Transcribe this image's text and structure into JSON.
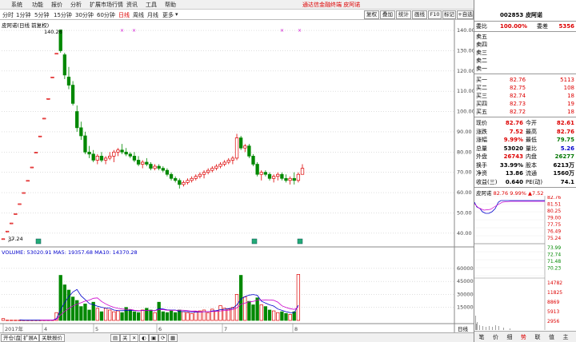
{
  "menu": [
    "系统",
    "功能",
    "报价",
    "分析",
    "扩展市场行情",
    "资讯",
    "工具",
    "帮助"
  ],
  "banner": "通达信金融终端  皮阿诺",
  "window_buttons": [
    "行情",
    "资讯",
    "交易",
    "服务"
  ],
  "periods": [
    "分时",
    "1分钟",
    "5分钟",
    "15分钟",
    "30分钟",
    "60分钟",
    "日线",
    "周线",
    "月线",
    "更多"
  ],
  "period_active": "日线",
  "toolbar_buttons": [
    "复权",
    "叠加",
    "统计",
    "画线",
    "F10",
    "标记",
    "+自选",
    "返回"
  ],
  "chart_title": "皮阿诺(日线 前复权)",
  "chart_data": {
    "type": "candlestick",
    "ylim": [
      34,
      142
    ],
    "yticks": [
      40,
      50,
      60,
      70,
      80,
      90,
      100,
      110,
      120,
      130,
      140
    ],
    "ytick_labels": [
      "40.00",
      "50.00",
      "60.00",
      "70.00",
      "80.00",
      "90.00",
      "100.00",
      "110.00",
      "120.00",
      "130.00",
      "140.00"
    ],
    "max_label": "140.26",
    "min_label": "37.24",
    "candles": [
      [
        37.24,
        37.24,
        37.24,
        37.24
      ],
      [
        41,
        41,
        41,
        41
      ],
      [
        45,
        45,
        45,
        45
      ],
      [
        49.6,
        49.6,
        49.6,
        49.6
      ],
      [
        54.5,
        54.5,
        54.5,
        54.5
      ],
      [
        60,
        60,
        60,
        60
      ],
      [
        66,
        66,
        66,
        66
      ],
      [
        72.6,
        72.6,
        72.6,
        72.6
      ],
      [
        79.9,
        79.9,
        79.9,
        79.9
      ],
      [
        87.9,
        87.9,
        87.9,
        87.9
      ],
      [
        96.7,
        96.7,
        96.7,
        96.7
      ],
      [
        106.4,
        106.4,
        106.4,
        106.4
      ],
      [
        117,
        117,
        117,
        117
      ],
      [
        128.7,
        128.7,
        128.7,
        128.7
      ],
      [
        140.26,
        129,
        140.26,
        130
      ],
      [
        128,
        116,
        129,
        118
      ],
      [
        117,
        111,
        122,
        113
      ],
      [
        113,
        103,
        115,
        104
      ],
      [
        100,
        90,
        103,
        92
      ],
      [
        92,
        86,
        95,
        88
      ],
      [
        88,
        79,
        90,
        80
      ],
      [
        80,
        77,
        83,
        79
      ],
      [
        79,
        75,
        81,
        76
      ],
      [
        76,
        74,
        79,
        78
      ],
      [
        78,
        75,
        80,
        76
      ],
      [
        76,
        74,
        78,
        77
      ],
      [
        77,
        76,
        80,
        78
      ],
      [
        78,
        75,
        81,
        80
      ],
      [
        80,
        78,
        82,
        81
      ],
      [
        81,
        79,
        84,
        80
      ],
      [
        80,
        78,
        82,
        79
      ],
      [
        79,
        77,
        80,
        78
      ],
      [
        78,
        75,
        80,
        76
      ],
      [
        76,
        73,
        78,
        74
      ],
      [
        74,
        72,
        76,
        75
      ],
      [
        75,
        73,
        77,
        74
      ],
      [
        74,
        71,
        75,
        72
      ],
      [
        72,
        71,
        74,
        73
      ],
      [
        73,
        71,
        74,
        72
      ],
      [
        72,
        70,
        73,
        71
      ],
      [
        71,
        68,
        72,
        69
      ],
      [
        69,
        66,
        70,
        67
      ],
      [
        67,
        65,
        68,
        66
      ],
      [
        66,
        62,
        67,
        64
      ],
      [
        64,
        63,
        66,
        65
      ],
      [
        65,
        64,
        67,
        66
      ],
      [
        66,
        65,
        68,
        67
      ],
      [
        67,
        66,
        69,
        68
      ],
      [
        68,
        67,
        70,
        69
      ],
      [
        69,
        67,
        71,
        70
      ],
      [
        70,
        69,
        72,
        71
      ],
      [
        71,
        70,
        73,
        72
      ],
      [
        72,
        71,
        74,
        73
      ],
      [
        73,
        72,
        75,
        74
      ],
      [
        74,
        73,
        76,
        75
      ],
      [
        75,
        74,
        77,
        76
      ],
      [
        76,
        74,
        78,
        77
      ],
      [
        77,
        76,
        89,
        87
      ],
      [
        87,
        81,
        88,
        82
      ],
      [
        82,
        80,
        84,
        83
      ],
      [
        83,
        77,
        84,
        78
      ],
      [
        78,
        73,
        79,
        74
      ],
      [
        74,
        68,
        75,
        69
      ],
      [
        69,
        66,
        71,
        70
      ],
      [
        70,
        68,
        71,
        69
      ],
      [
        69,
        66,
        70,
        67
      ],
      [
        67,
        65,
        69,
        68
      ],
      [
        68,
        66,
        70,
        69
      ],
      [
        69,
        66,
        70,
        67
      ],
      [
        67,
        65,
        69,
        66
      ],
      [
        66,
        64,
        68,
        67
      ],
      [
        67,
        64,
        70,
        66
      ],
      [
        66,
        65,
        70,
        69
      ],
      [
        69,
        72,
        74,
        72
      ]
    ],
    "volume_title": "VOLUME: 53020.91  MA5: 19357.68  MA10: 14370.28",
    "volume_ylim": [
      0,
      70000
    ],
    "volume_ticks": [
      15000,
      30000,
      45000,
      60000
    ],
    "volumes": [
      2100,
      300,
      280,
      260,
      250,
      240,
      230,
      230,
      230,
      240,
      260,
      280,
      320,
      9000,
      52000,
      41000,
      35000,
      27000,
      23000,
      16000,
      19000,
      12000,
      21000,
      14000,
      10000,
      14000,
      12000,
      10000,
      11000,
      9000,
      15000,
      12000,
      10000,
      9000,
      12000,
      14000,
      12000,
      9000,
      21000,
      10000,
      9000,
      11000,
      9000,
      12000,
      10000,
      9000,
      8000,
      10000,
      11000,
      12000,
      9000,
      13000,
      11000,
      17000,
      14000,
      13000,
      15000,
      30000,
      52000,
      27000,
      22000,
      18000,
      26000,
      18000,
      16000,
      12000,
      11000,
      9000,
      10000,
      8000,
      7000,
      10000,
      53000
    ],
    "dates": [
      "2017年",
      "4",
      "5",
      "6",
      "7",
      "8"
    ],
    "date_label": "日线"
  },
  "chart_tabs": [
    "开仓(盘",
    "扩展A",
    "关联报价"
  ],
  "stock": {
    "code": "002853",
    "name": "皮阿诺"
  },
  "quote": {
    "webi_label": "委比",
    "webi": "100.00%",
    "weicha_label": "委差",
    "weicha": "5356",
    "asks": [
      {
        "l": "卖五",
        "p": "",
        "v": ""
      },
      {
        "l": "卖四",
        "p": "",
        "v": ""
      },
      {
        "l": "卖三",
        "p": "",
        "v": ""
      },
      {
        "l": "卖二",
        "p": "",
        "v": ""
      },
      {
        "l": "卖一",
        "p": "",
        "v": ""
      }
    ],
    "bids": [
      {
        "l": "买一",
        "p": "82.76",
        "v": "5113"
      },
      {
        "l": "买二",
        "p": "82.75",
        "v": "108"
      },
      {
        "l": "买三",
        "p": "82.74",
        "v": "18"
      },
      {
        "l": "买四",
        "p": "82.73",
        "v": "19"
      },
      {
        "l": "买五",
        "p": "82.72",
        "v": "18"
      }
    ],
    "stats": [
      {
        "l1": "现价",
        "v1": "82.76",
        "l2": "今开",
        "v2": "82.61"
      },
      {
        "l1": "涨跌",
        "v1": "7.52",
        "l2": "最高",
        "v2": "82.76"
      },
      {
        "l1": "涨幅",
        "v1": "9.99%",
        "l2": "最低",
        "v2": "79.75"
      },
      {
        "l1": "总量",
        "v1": "53020",
        "l2": "量比",
        "v2": "5.26"
      },
      {
        "l1": "外盘",
        "v1": "26743",
        "l2": "内盘",
        "v2": "26277"
      },
      {
        "l1": "换手",
        "v1": "33.99%",
        "l2": "股本",
        "v2": "6213万"
      },
      {
        "l1": "净资",
        "v1": "13.86",
        "l2": "流通",
        "v2": "1560万"
      },
      {
        "l1": "收益(三)",
        "v1": "0.640",
        "l2": "PE(动)",
        "v2": "74.1"
      }
    ]
  },
  "mini": {
    "name": "皮阿诺",
    "price": "82.76",
    "pct": "9.99%",
    "chg": "▲7.52",
    "price_ticks": [
      "82.76",
      "81.51",
      "80.25",
      "79.00",
      "77.75",
      "76.49",
      "75.24"
    ],
    "pct_ticks": [
      "73.99",
      "72.74",
      "71.48",
      "70.23"
    ],
    "vol_ticks": [
      "14782",
      "11825",
      "8869",
      "5913",
      "2956"
    ]
  },
  "bottom_icons": [
    "笔",
    "价",
    "细",
    "势",
    "联",
    "值",
    "主"
  ]
}
